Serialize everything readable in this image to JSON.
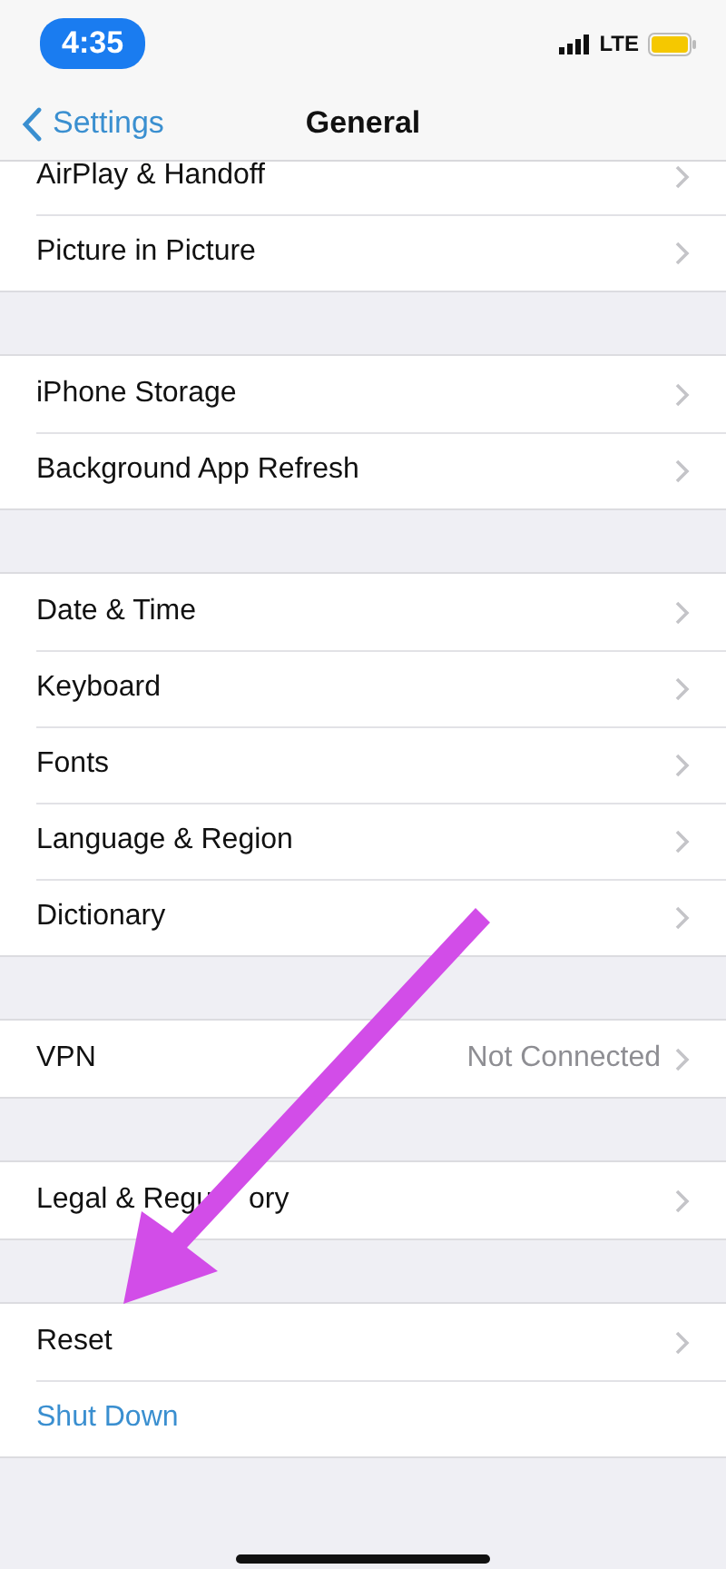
{
  "status_bar": {
    "time": "4:35",
    "network": "LTE"
  },
  "nav_bar": {
    "back": "Settings",
    "title": "General"
  },
  "groups": [
    [
      {
        "kind": "link",
        "label": "AirPlay & Handoff"
      },
      {
        "kind": "link",
        "label": "Picture in Picture"
      }
    ],
    [
      {
        "kind": "link",
        "label": "iPhone Storage"
      },
      {
        "kind": "link",
        "label": "Background App Refresh"
      }
    ],
    [
      {
        "kind": "link",
        "label": "Date & Time"
      },
      {
        "kind": "link",
        "label": "Keyboard"
      },
      {
        "kind": "link",
        "label": "Fonts"
      },
      {
        "kind": "link",
        "label": "Language & Region"
      },
      {
        "kind": "link",
        "label": "Dictionary"
      }
    ],
    [
      {
        "kind": "link",
        "label": "VPN",
        "value": "Not Connected"
      }
    ],
    [
      {
        "kind": "link",
        "label": "Legal & Regu",
        "label_tail": "ory"
      }
    ],
    [
      {
        "kind": "link",
        "label": "Reset"
      },
      {
        "kind": "action",
        "label": "Shut Down"
      }
    ]
  ]
}
